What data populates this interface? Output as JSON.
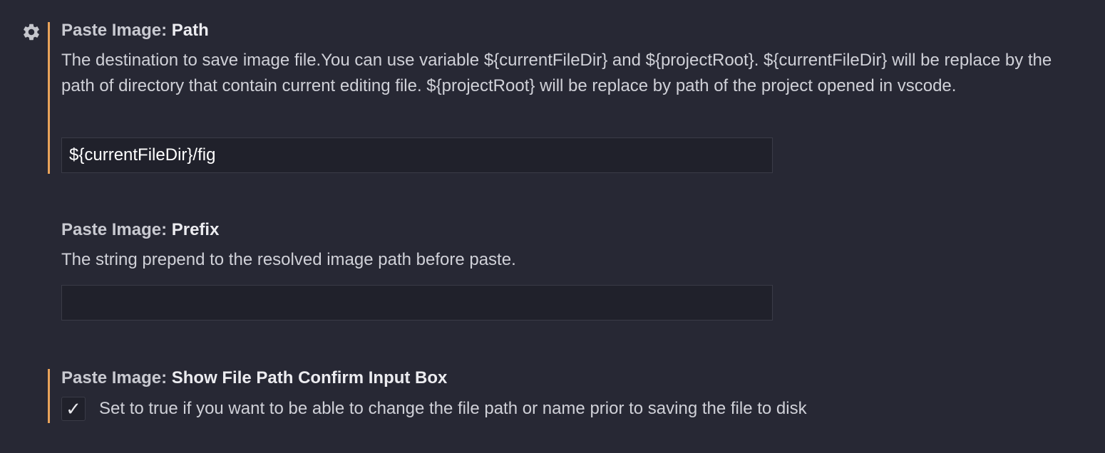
{
  "colors": {
    "background": "#272834",
    "modified_indicator": "#e9a35a",
    "input_background": "#20212b"
  },
  "settings": [
    {
      "category": "Paste Image: ",
      "name": "Path",
      "description": "The destination to save image file.You can use variable ${currentFileDir} and ${projectRoot}. ${currentFileDir} will be replace by the path of directory that contain current editing file. ${projectRoot} will be replace by path of the project opened in vscode.",
      "type": "text",
      "value": "${currentFileDir}/fig",
      "modified": true,
      "icon": "gear-icon"
    },
    {
      "category": "Paste Image: ",
      "name": "Prefix",
      "description": "The string prepend to the resolved image path before paste.",
      "type": "text",
      "value": "",
      "modified": false
    },
    {
      "category": "Paste Image: ",
      "name": "Show File Path Confirm Input Box",
      "description": "Set to true if you want to be able to change the file path or name prior to saving the file to disk",
      "type": "checkbox",
      "checked": true,
      "check_glyph": "✓",
      "modified": true
    }
  ]
}
